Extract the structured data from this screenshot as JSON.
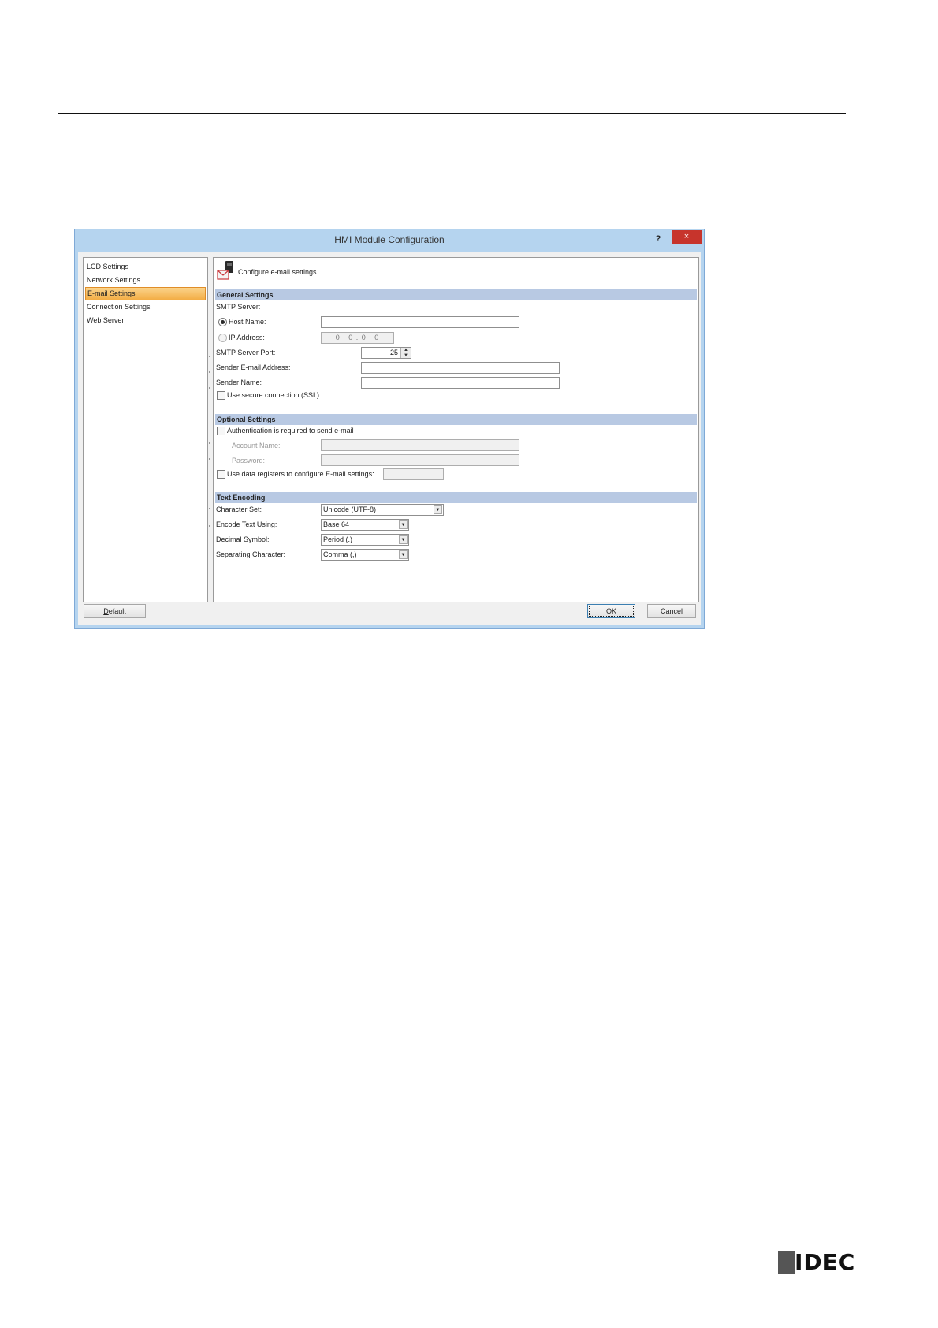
{
  "dialog": {
    "title": "HMI Module Configuration",
    "help": "?",
    "close": "×"
  },
  "nav": {
    "items": [
      {
        "label": "LCD Settings"
      },
      {
        "label": "Network Settings"
      },
      {
        "label": "E-mail Settings",
        "selected": true
      },
      {
        "label": "Connection Settings"
      },
      {
        "label": "Web Server"
      }
    ]
  },
  "content": {
    "header_text": "Configure e-mail settings.",
    "general": {
      "title": "General Settings",
      "smtp_server_label": "SMTP Server:",
      "host_name_label": "Host Name:",
      "host_name_value": "",
      "ip_address_label": "IP Address:",
      "ip_address_value": "0 . 0 . 0 . 0",
      "smtp_port_label": "SMTP Server Port:",
      "smtp_port_value": "25",
      "sender_email_label": "Sender E-mail Address:",
      "sender_email_value": "",
      "sender_name_label": "Sender Name:",
      "sender_name_value": "",
      "ssl_label": "Use secure connection (SSL)"
    },
    "optional": {
      "title": "Optional Settings",
      "auth_label": "Authentication is required to send e-mail",
      "account_label": "Account Name:",
      "password_label": "Password:",
      "data_reg_label": "Use data registers to configure E-mail settings:"
    },
    "encoding": {
      "title": "Text Encoding",
      "charset_label": "Character Set:",
      "charset_value": "Unicode (UTF-8)",
      "encode_label": "Encode Text Using:",
      "encode_value": "Base 64",
      "decimal_label": "Decimal Symbol:",
      "decimal_value": "Period (.)",
      "separator_label": "Separating Character:",
      "separator_value": "Comma (,)"
    }
  },
  "footer": {
    "default_label": "Default",
    "ok_label": "OK",
    "cancel_label": "Cancel"
  },
  "brand": {
    "logo_text": "IDEC"
  }
}
